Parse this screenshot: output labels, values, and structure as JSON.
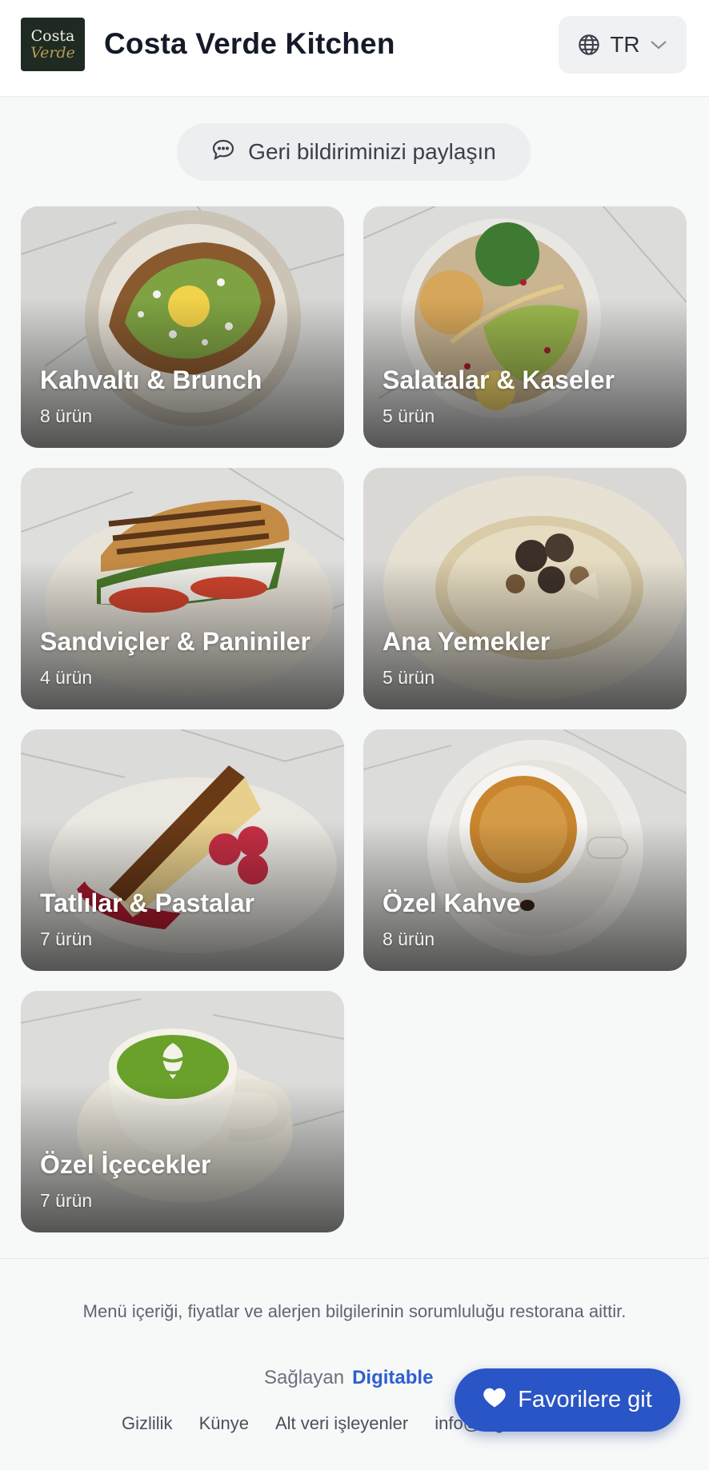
{
  "header": {
    "logo_line1": "Costa",
    "logo_line2": "Verde",
    "title": "Costa Verde Kitchen",
    "language": "TR",
    "icons": [
      "globe-icon",
      "chevron-down-icon"
    ]
  },
  "feedback": {
    "label": "Geri bildiriminizi paylaşın",
    "icon": "chat-bubble-icon"
  },
  "categories": [
    {
      "name": "Kahvaltı & Brunch",
      "count": "8 ürün"
    },
    {
      "name": "Salatalar & Kaseler",
      "count": "5 ürün"
    },
    {
      "name": "Sandviçler & Paniniler",
      "count": "4 ürün"
    },
    {
      "name": "Ana Yemekler",
      "count": "5 ürün"
    },
    {
      "name": "Tatlılar & Pastalar",
      "count": "7 ürün"
    },
    {
      "name": "Özel Kahve",
      "count": "8 ürün"
    },
    {
      "name": "Özel İçecekler",
      "count": "7 ürün"
    }
  ],
  "footer": {
    "disclaimer": "Menü içeriği, fiyatlar ve alerjen bilgilerinin sorumluluğu restorana aittir.",
    "provided_by": "Sağlayan",
    "provider_name": "Digitable",
    "links": [
      "Gizlilik",
      "Künye",
      "Alt veri işleyenler",
      "info@dig"
    ]
  },
  "favorites_button": {
    "label": "Favorilere git",
    "icon": "heart-icon"
  },
  "colors": {
    "accent": "#2a55c6",
    "brand_link": "#2f5fd0",
    "logo_bg": "#1f2b22"
  }
}
